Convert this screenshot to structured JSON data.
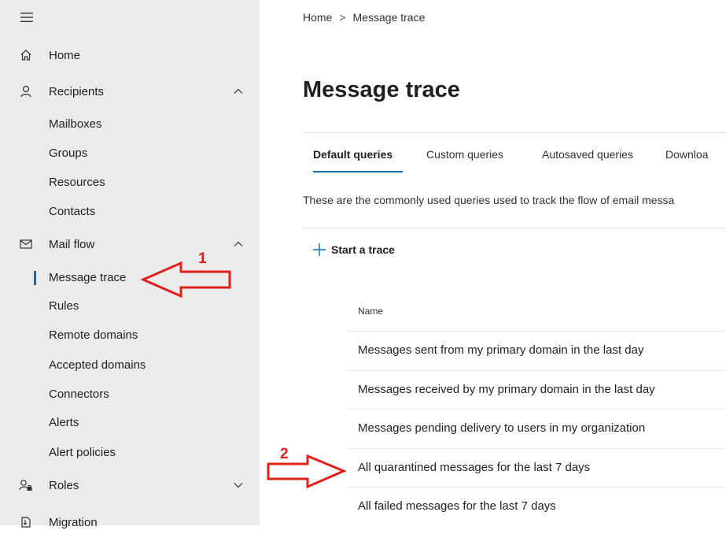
{
  "sidebar": {
    "items": [
      {
        "label": "Home"
      },
      {
        "label": "Recipients"
      },
      {
        "label": "Mail flow"
      },
      {
        "label": "Roles"
      },
      {
        "label": "Migration"
      }
    ],
    "recipients_sub": [
      "Mailboxes",
      "Groups",
      "Resources",
      "Contacts"
    ],
    "mailflow_sub": [
      "Message trace",
      "Rules",
      "Remote domains",
      "Accepted domains",
      "Connectors",
      "Alerts",
      "Alert policies"
    ]
  },
  "breadcrumb": {
    "home": "Home",
    "separator": ">",
    "current": "Message trace"
  },
  "page": {
    "title": "Message trace",
    "tabs": [
      "Default queries",
      "Custom queries",
      "Autosaved queries",
      "Downloa"
    ],
    "description": "These are the commonly used queries used to track the flow of email messa",
    "start_trace": "Start a trace",
    "column_name": "Name",
    "rows": [
      "Messages sent from my primary domain in the last day",
      "Messages received by my primary domain in the last day",
      "Messages pending delivery to users in my organization",
      "All quarantined messages for the last 7 days",
      "All failed messages for the last 7 days"
    ]
  },
  "annotations": {
    "first": "1",
    "second": "2",
    "color": "#e0201b"
  },
  "colors": {
    "sidebar_bg": "#ebebeb",
    "accent": "#0f6cbd"
  }
}
